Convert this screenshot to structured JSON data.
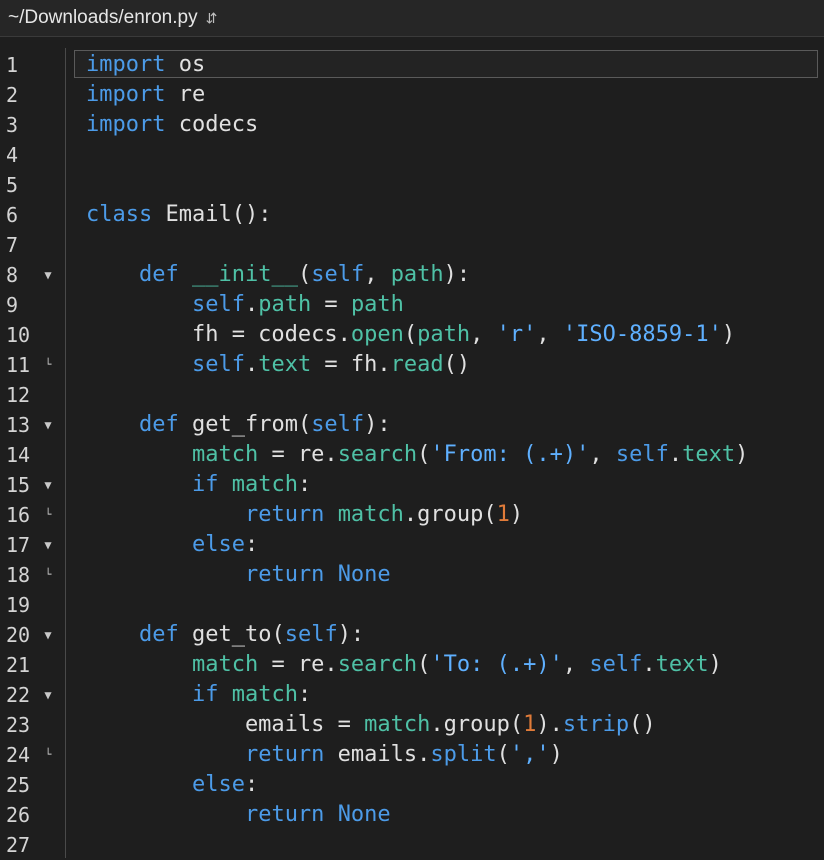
{
  "window": {
    "title": "~/Downloads/enron.py",
    "chevron_icon": "updown-chevron-icon"
  },
  "colors": {
    "background": "#1e1e1e",
    "keyword": "#4c9be8",
    "function": "#4fc1a6",
    "string": "#5fb0ff",
    "number": "#e07b39",
    "text": "#e0e0e0"
  },
  "editor": {
    "current_line": 1,
    "lines": [
      {
        "n": "1",
        "fold": "",
        "tokens": [
          [
            "kw",
            "import"
          ],
          [
            "op",
            " os"
          ]
        ]
      },
      {
        "n": "2",
        "fold": "",
        "tokens": [
          [
            "kw",
            "import"
          ],
          [
            "op",
            " re"
          ]
        ]
      },
      {
        "n": "3",
        "fold": "",
        "tokens": [
          [
            "kw",
            "import"
          ],
          [
            "op",
            " codecs"
          ]
        ]
      },
      {
        "n": "4",
        "fold": "",
        "tokens": []
      },
      {
        "n": "5",
        "fold": "",
        "tokens": []
      },
      {
        "n": "6",
        "fold": "",
        "tokens": [
          [
            "kw",
            "class"
          ],
          [
            "op",
            " Email():"
          ]
        ]
      },
      {
        "n": "7",
        "fold": "",
        "tokens": []
      },
      {
        "n": "8",
        "fold": "open",
        "tokens": [
          [
            "op",
            "    "
          ],
          [
            "kw",
            "def"
          ],
          [
            "op",
            " "
          ],
          [
            "fn",
            "__init__"
          ],
          [
            "op",
            "("
          ],
          [
            "self",
            "self"
          ],
          [
            "op",
            ", "
          ],
          [
            "fn",
            "path"
          ],
          [
            "op",
            "):"
          ]
        ]
      },
      {
        "n": "9",
        "fold": "",
        "tokens": [
          [
            "op",
            "        "
          ],
          [
            "self",
            "self"
          ],
          [
            "op",
            "."
          ],
          [
            "fn",
            "path"
          ],
          [
            "op",
            " = "
          ],
          [
            "fn",
            "path"
          ]
        ]
      },
      {
        "n": "10",
        "fold": "",
        "tokens": [
          [
            "op",
            "        fh = codecs."
          ],
          [
            "fn",
            "open"
          ],
          [
            "op",
            "("
          ],
          [
            "fn",
            "path"
          ],
          [
            "op",
            ", "
          ],
          [
            "str",
            "'r'"
          ],
          [
            "op",
            ", "
          ],
          [
            "str",
            "'ISO-8859-1'"
          ],
          [
            "op",
            ")"
          ]
        ]
      },
      {
        "n": "11",
        "fold": "end",
        "tokens": [
          [
            "op",
            "        "
          ],
          [
            "self",
            "self"
          ],
          [
            "op",
            "."
          ],
          [
            "fn",
            "text"
          ],
          [
            "op",
            " = fh."
          ],
          [
            "fn",
            "read"
          ],
          [
            "op",
            "()"
          ]
        ]
      },
      {
        "n": "12",
        "fold": "",
        "tokens": []
      },
      {
        "n": "13",
        "fold": "open",
        "tokens": [
          [
            "op",
            "    "
          ],
          [
            "kw",
            "def"
          ],
          [
            "op",
            " get_from("
          ],
          [
            "self",
            "self"
          ],
          [
            "op",
            "):"
          ]
        ]
      },
      {
        "n": "14",
        "fold": "",
        "tokens": [
          [
            "op",
            "        "
          ],
          [
            "fn",
            "match"
          ],
          [
            "op",
            " = re."
          ],
          [
            "fn",
            "search"
          ],
          [
            "op",
            "("
          ],
          [
            "str",
            "'From: (.+)'"
          ],
          [
            "op",
            ", "
          ],
          [
            "self",
            "self"
          ],
          [
            "op",
            "."
          ],
          [
            "fn",
            "text"
          ],
          [
            "op",
            ")"
          ]
        ]
      },
      {
        "n": "15",
        "fold": "open",
        "tokens": [
          [
            "op",
            "        "
          ],
          [
            "kw",
            "if"
          ],
          [
            "op",
            " "
          ],
          [
            "fn",
            "match"
          ],
          [
            "op",
            ":"
          ]
        ]
      },
      {
        "n": "16",
        "fold": "end",
        "tokens": [
          [
            "op",
            "            "
          ],
          [
            "kw",
            "return"
          ],
          [
            "op",
            " "
          ],
          [
            "fn",
            "match"
          ],
          [
            "op",
            ".group("
          ],
          [
            "num",
            "1"
          ],
          [
            "op",
            ")"
          ]
        ]
      },
      {
        "n": "17",
        "fold": "open",
        "tokens": [
          [
            "op",
            "        "
          ],
          [
            "kw",
            "else"
          ],
          [
            "op",
            ":"
          ]
        ]
      },
      {
        "n": "18",
        "fold": "end",
        "tokens": [
          [
            "op",
            "            "
          ],
          [
            "kw",
            "return"
          ],
          [
            "op",
            " "
          ],
          [
            "kw",
            "None"
          ]
        ]
      },
      {
        "n": "19",
        "fold": "",
        "tokens": []
      },
      {
        "n": "20",
        "fold": "open",
        "tokens": [
          [
            "op",
            "    "
          ],
          [
            "kw",
            "def"
          ],
          [
            "op",
            " get_to("
          ],
          [
            "self",
            "self"
          ],
          [
            "op",
            "):"
          ]
        ]
      },
      {
        "n": "21",
        "fold": "",
        "tokens": [
          [
            "op",
            "        "
          ],
          [
            "fn",
            "match"
          ],
          [
            "op",
            " = re."
          ],
          [
            "fn",
            "search"
          ],
          [
            "op",
            "("
          ],
          [
            "str",
            "'To: (.+)'"
          ],
          [
            "op",
            ", "
          ],
          [
            "self",
            "self"
          ],
          [
            "op",
            "."
          ],
          [
            "fn",
            "text"
          ],
          [
            "op",
            ")"
          ]
        ]
      },
      {
        "n": "22",
        "fold": "open",
        "tokens": [
          [
            "op",
            "        "
          ],
          [
            "kw",
            "if"
          ],
          [
            "op",
            " "
          ],
          [
            "fn",
            "match"
          ],
          [
            "op",
            ":"
          ]
        ]
      },
      {
        "n": "23",
        "fold": "",
        "tokens": [
          [
            "op",
            "            emails = "
          ],
          [
            "fn",
            "match"
          ],
          [
            "op",
            ".group("
          ],
          [
            "num",
            "1"
          ],
          [
            "op",
            ")."
          ],
          [
            "self",
            "strip"
          ],
          [
            "op",
            "()"
          ]
        ]
      },
      {
        "n": "24",
        "fold": "end",
        "tokens": [
          [
            "op",
            "            "
          ],
          [
            "kw",
            "return"
          ],
          [
            "op",
            " emails."
          ],
          [
            "self",
            "split"
          ],
          [
            "op",
            "("
          ],
          [
            "str",
            "','"
          ],
          [
            "op",
            ")"
          ]
        ]
      },
      {
        "n": "25",
        "fold": "",
        "tokens": [
          [
            "op",
            "        "
          ],
          [
            "kw",
            "else"
          ],
          [
            "op",
            ":"
          ]
        ]
      },
      {
        "n": "26",
        "fold": "",
        "tokens": [
          [
            "op",
            "            "
          ],
          [
            "kw",
            "return"
          ],
          [
            "op",
            " "
          ],
          [
            "kw",
            "None"
          ]
        ]
      },
      {
        "n": "27",
        "fold": "",
        "tokens": []
      }
    ]
  }
}
